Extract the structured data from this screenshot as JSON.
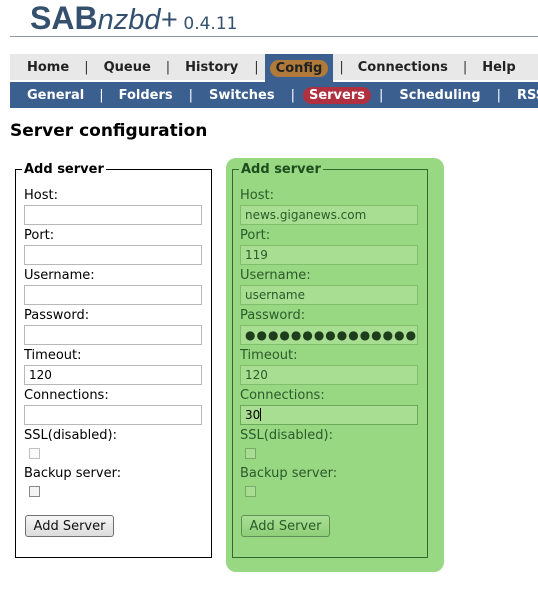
{
  "app": {
    "logo_main": "SAB",
    "logo_italic": "nzbd+",
    "version": "0.4.11"
  },
  "nav_primary": {
    "items": [
      "Home",
      "Queue",
      "History",
      "Config",
      "Connections",
      "Help"
    ],
    "active": "Config",
    "separator": "|"
  },
  "nav_secondary": {
    "items": [
      "General",
      "Folders",
      "Switches",
      "Servers",
      "Scheduling",
      "RSS"
    ],
    "active": "Servers",
    "separator": "|"
  },
  "page": {
    "title": "Server configuration"
  },
  "form_empty": {
    "legend": "Add server",
    "host_label": "Host:",
    "host_value": "",
    "port_label": "Port:",
    "port_value": "",
    "username_label": "Username:",
    "username_value": "",
    "password_label": "Password:",
    "password_value": "",
    "timeout_label": "Timeout:",
    "timeout_value": "120",
    "connections_label": "Connections:",
    "connections_value": "",
    "ssl_label": "SSL(disabled):",
    "backup_label": "Backup server:",
    "submit_label": "Add Server"
  },
  "form_filled": {
    "legend": "Add server",
    "host_label": "Host:",
    "host_value": "news.giganews.com",
    "port_label": "Port:",
    "port_value": "119",
    "username_label": "Username:",
    "username_value": "username",
    "password_label": "Password:",
    "password_mask": "●●●●●●●●●●●●●●●●●●",
    "timeout_label": "Timeout:",
    "timeout_value": "120",
    "connections_label": "Connections:",
    "connections_value": "30",
    "ssl_label": "SSL(disabled):",
    "backup_label": "Backup server:",
    "submit_label": "Add Server"
  },
  "colors": {
    "header_text": "#34506e",
    "nav_secondary_bg": "#3b5f8f",
    "config_pill": "#b07a3a",
    "servers_pill": "#b03040",
    "highlight_panel": "#99d883"
  }
}
